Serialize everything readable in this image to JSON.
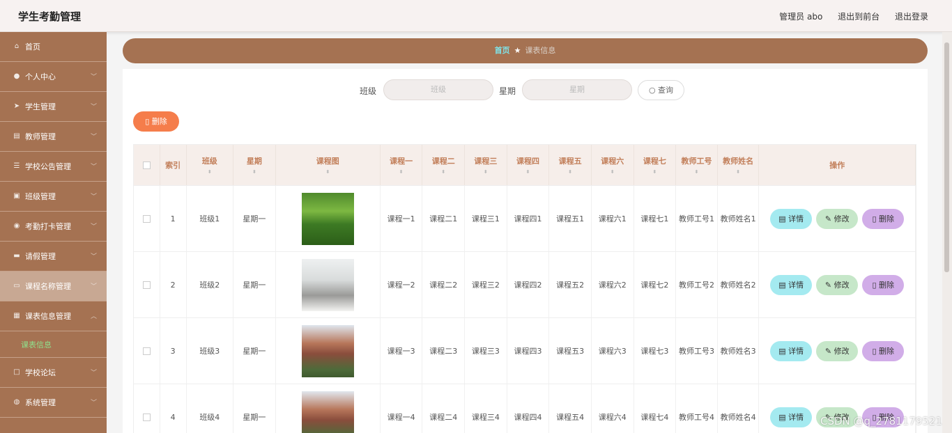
{
  "header": {
    "app_title": "学生考勤管理",
    "user_label": "管理员 abo",
    "to_front": "退出到前台",
    "logout": "退出登录"
  },
  "sidebar": {
    "items": [
      {
        "label": "首页",
        "icon": "home-icon"
      },
      {
        "label": "个人中心",
        "icon": "user-icon"
      },
      {
        "label": "学生管理",
        "icon": "send-icon"
      },
      {
        "label": "教师管理",
        "icon": "doc-icon"
      },
      {
        "label": "学校公告管理",
        "icon": "list-icon"
      },
      {
        "label": "班级管理",
        "icon": "clipboard-icon"
      },
      {
        "label": "考勤打卡管理",
        "icon": "location-icon"
      },
      {
        "label": "请假管理",
        "icon": "briefcase-icon"
      },
      {
        "label": "课程名称管理",
        "icon": "chat-icon"
      },
      {
        "label": "课表信息管理",
        "icon": "grid-icon"
      },
      {
        "label": "学校论坛",
        "icon": "square-icon"
      },
      {
        "label": "系统管理",
        "icon": "globe-icon"
      }
    ],
    "submenu": "课表信息"
  },
  "breadcrumb": {
    "home": "首页",
    "current": "课表信息"
  },
  "search": {
    "class_label": "班级",
    "class_placeholder": "班级",
    "week_label": "星期",
    "week_placeholder": "星期",
    "query_button": "查询"
  },
  "toolbar": {
    "delete_button": "删除"
  },
  "table": {
    "headers": [
      "索引",
      "班级",
      "星期",
      "课程图",
      "课程一",
      "课程二",
      "课程三",
      "课程四",
      "课程五",
      "课程六",
      "课程七",
      "教师工号",
      "教师姓名",
      "操作"
    ],
    "rows": [
      {
        "index": "1",
        "class": "班级1",
        "week": "星期一",
        "c1": "课程一1",
        "c2": "课程二1",
        "c3": "课程三1",
        "c4": "课程四1",
        "c5": "课程五1",
        "c6": "课程六1",
        "c7": "课程七1",
        "tno": "教师工号1",
        "tname": "教师姓名1"
      },
      {
        "index": "2",
        "class": "班级2",
        "week": "星期一",
        "c1": "课程一2",
        "c2": "课程二2",
        "c3": "课程三2",
        "c4": "课程四2",
        "c5": "课程五2",
        "c6": "课程六2",
        "c7": "课程七2",
        "tno": "教师工号2",
        "tname": "教师姓名2"
      },
      {
        "index": "3",
        "class": "班级3",
        "week": "星期一",
        "c1": "课程一3",
        "c2": "课程二3",
        "c3": "课程三3",
        "c4": "课程四3",
        "c5": "课程五3",
        "c6": "课程六3",
        "c7": "课程七3",
        "tno": "教师工号3",
        "tname": "教师姓名3"
      },
      {
        "index": "4",
        "class": "班级4",
        "week": "星期一",
        "c1": "课程一4",
        "c2": "课程二4",
        "c3": "课程三4",
        "c4": "课程四4",
        "c5": "课程五4",
        "c6": "课程六4",
        "c7": "课程七4",
        "tno": "教师工号4",
        "tname": "教师姓名4"
      }
    ],
    "actions": {
      "detail": "详情",
      "edit": "修改",
      "delete": "删除"
    }
  },
  "watermark": "CSDN @q_2781179521",
  "colors": {
    "sidebar_bg": "#a57252",
    "accent_orange": "#f57d4b",
    "detail_btn": "#a4eaf0",
    "edit_btn": "#c6e7c9",
    "delete_btn": "#d1ade8"
  }
}
